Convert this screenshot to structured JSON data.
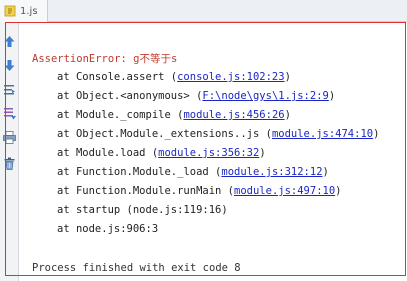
{
  "tab": {
    "label": "1.js",
    "icon": "js-file-icon"
  },
  "toolbar": {
    "items": [
      {
        "name": "up-arrow-icon"
      },
      {
        "name": "down-arrow-icon"
      },
      {
        "name": "soft-wrap-icon"
      },
      {
        "name": "scroll-to-end-icon"
      },
      {
        "name": "print-icon"
      },
      {
        "name": "trash-icon"
      }
    ]
  },
  "console": {
    "error": "AssertionError: g不等于s",
    "trace": [
      {
        "prefix": "at Console.assert (",
        "link": "console.js:102:23",
        "suffix": ")"
      },
      {
        "prefix": "at Object.<anonymous> (",
        "link": "F:\\node\\gys\\1.js:2:9",
        "suffix": ")"
      },
      {
        "prefix": "at Module._compile (",
        "link": "module.js:456:26",
        "suffix": ")"
      },
      {
        "prefix": "at Object.Module._extensions..js (",
        "link": "module.js:474:10",
        "suffix": ")"
      },
      {
        "prefix": "at Module.load (",
        "link": "module.js:356:32",
        "suffix": ")"
      },
      {
        "prefix": "at Function.Module._load (",
        "link": "module.js:312:12",
        "suffix": ")"
      },
      {
        "prefix": "at Function.Module.runMain (",
        "link": "module.js:497:10",
        "suffix": ")"
      },
      {
        "prefix": "at startup (node.js:119:16)",
        "link": "",
        "suffix": ""
      },
      {
        "prefix": "at node.js:906:3",
        "link": "",
        "suffix": ""
      }
    ],
    "exit": "Process finished with exit code 8"
  },
  "colors": {
    "error": "#c0392b",
    "link": "#1b27c4",
    "frame": "#e03030"
  }
}
